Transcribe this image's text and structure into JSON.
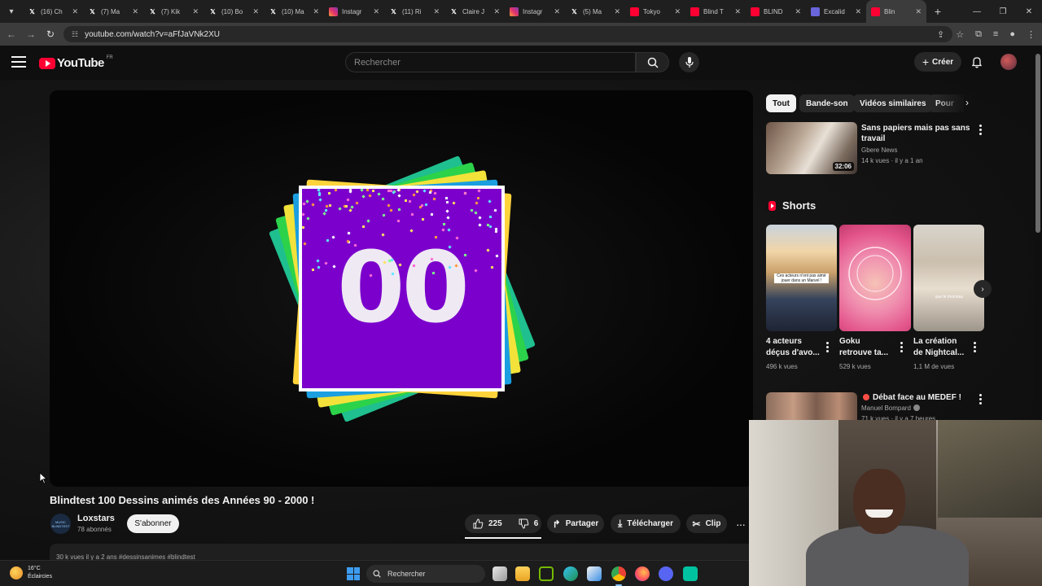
{
  "browser": {
    "tabs": [
      {
        "title": "(16) Ch",
        "icon": "x-logo"
      },
      {
        "title": "(7) Ma",
        "icon": "x-logo"
      },
      {
        "title": "(7) Kik",
        "icon": "x-logo"
      },
      {
        "title": "(10) Bo",
        "icon": "x-logo"
      },
      {
        "title": "(10) Ma",
        "icon": "x-logo"
      },
      {
        "title": "Instagr",
        "icon": "ig"
      },
      {
        "title": "(11) Ri",
        "icon": "x-logo"
      },
      {
        "title": "Claire J",
        "icon": "x-logo"
      },
      {
        "title": "Instagr",
        "icon": "ig"
      },
      {
        "title": "(5) Ma",
        "icon": "x-logo"
      },
      {
        "title": "Tokyo",
        "icon": "yt"
      },
      {
        "title": "Blind T",
        "icon": "yt"
      },
      {
        "title": "BLIND",
        "icon": "yt"
      },
      {
        "title": "Excalid",
        "icon": "ex"
      },
      {
        "title": "Blin",
        "icon": "yt",
        "active": true
      }
    ],
    "url": "youtube.com/watch?v=aFfJaVNk2XU"
  },
  "masthead": {
    "logo_text": "YouTube",
    "country_code": "FR",
    "search_placeholder": "Rechercher",
    "create_label": "Créer"
  },
  "player": {
    "counter_text": "00",
    "card_colors": [
      "#1fbf8f",
      "#2cd24a",
      "#f2e23a",
      "#1b9fe0",
      "#ffd43b"
    ],
    "face_color": "#7b00cc"
  },
  "video": {
    "title": "Blindtest 100 Dessins animés des Années 90 - 2000 !",
    "channel": {
      "name": "Loxstars",
      "subscribers": "78 abonnés",
      "avatar_text": "MUSIC BLINDTEST"
    },
    "subscribe_label": "S'abonner",
    "likes": "225",
    "dislikes": "6",
    "share_label": "Partager",
    "download_label": "Télécharger",
    "clip_label": "Clip",
    "description_preview": "30 k vues  il y a 2 ans  #dessinsanimes #blindtest"
  },
  "sidebar": {
    "chips": [
      {
        "label": "Tout",
        "active": true
      },
      {
        "label": "Bande-son"
      },
      {
        "label": "Vidéos similaires"
      },
      {
        "label": "Pour"
      }
    ],
    "recommended": [
      {
        "title_line1": "Sans papiers mais pas sans",
        "title_line2": "travail",
        "channel": "Gbere News",
        "meta": "14 k vues · il y a 1 an",
        "duration": "32:06"
      },
      {
        "title": "Débat face au MEDEF !",
        "channel": "Manuel Bompard",
        "meta": "71 k vues · il y a 7 heures"
      }
    ],
    "shorts_header": "Shorts",
    "shorts": [
      {
        "title_line1": "4 acteurs",
        "title_line2": "déçus d'avo...",
        "views": "496 k vues",
        "caption": "Ces acteurs n'ont pas aimé jouer dans un Marvel !"
      },
      {
        "title_line1": "Goku",
        "title_line2": "retrouve ta...",
        "views": "529 k vues",
        "caption": ""
      },
      {
        "title_line1": "La création",
        "title_line2": "de Nightcal...",
        "views": "1,1 M de vues",
        "caption": "que le morceau"
      }
    ]
  },
  "taskbar": {
    "temperature": "16°C",
    "weather": "Éclaircies",
    "search_label": "Rechercher"
  }
}
